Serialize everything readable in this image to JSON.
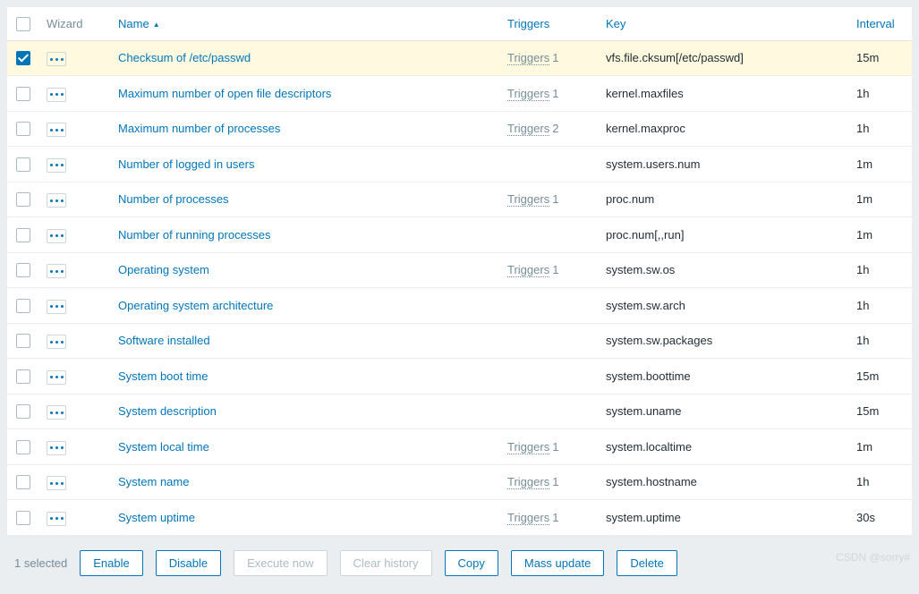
{
  "columns": {
    "wizard": "Wizard",
    "name": "Name",
    "triggers": "Triggers",
    "key": "Key",
    "interval": "Interval"
  },
  "triggers_label": "Triggers",
  "items": [
    {
      "checked": true,
      "name": "Checksum of /etc/passwd",
      "triggers_count": 1,
      "key": "vfs.file.cksum[/etc/passwd]",
      "interval": "15m"
    },
    {
      "checked": false,
      "name": "Maximum number of open file descriptors",
      "triggers_count": 1,
      "key": "kernel.maxfiles",
      "interval": "1h"
    },
    {
      "checked": false,
      "name": "Maximum number of processes",
      "triggers_count": 2,
      "key": "kernel.maxproc",
      "interval": "1h"
    },
    {
      "checked": false,
      "name": "Number of logged in users",
      "triggers_count": null,
      "key": "system.users.num",
      "interval": "1m"
    },
    {
      "checked": false,
      "name": "Number of processes",
      "triggers_count": 1,
      "key": "proc.num",
      "interval": "1m"
    },
    {
      "checked": false,
      "name": "Number of running processes",
      "triggers_count": null,
      "key": "proc.num[,,run]",
      "interval": "1m"
    },
    {
      "checked": false,
      "name": "Operating system",
      "triggers_count": 1,
      "key": "system.sw.os",
      "interval": "1h"
    },
    {
      "checked": false,
      "name": "Operating system architecture",
      "triggers_count": null,
      "key": "system.sw.arch",
      "interval": "1h"
    },
    {
      "checked": false,
      "name": "Software installed",
      "triggers_count": null,
      "key": "system.sw.packages",
      "interval": "1h"
    },
    {
      "checked": false,
      "name": "System boot time",
      "triggers_count": null,
      "key": "system.boottime",
      "interval": "15m"
    },
    {
      "checked": false,
      "name": "System description",
      "triggers_count": null,
      "key": "system.uname",
      "interval": "15m"
    },
    {
      "checked": false,
      "name": "System local time",
      "triggers_count": 1,
      "key": "system.localtime",
      "interval": "1m"
    },
    {
      "checked": false,
      "name": "System name",
      "triggers_count": 1,
      "key": "system.hostname",
      "interval": "1h"
    },
    {
      "checked": false,
      "name": "System uptime",
      "triggers_count": 1,
      "key": "system.uptime",
      "interval": "30s"
    }
  ],
  "footer": {
    "selected_text": "1 selected",
    "enable": "Enable",
    "disable": "Disable",
    "execute_now": "Execute now",
    "clear_history": "Clear history",
    "copy": "Copy",
    "mass_update": "Mass update",
    "delete": "Delete"
  },
  "watermark": "CSDN @sorry#"
}
